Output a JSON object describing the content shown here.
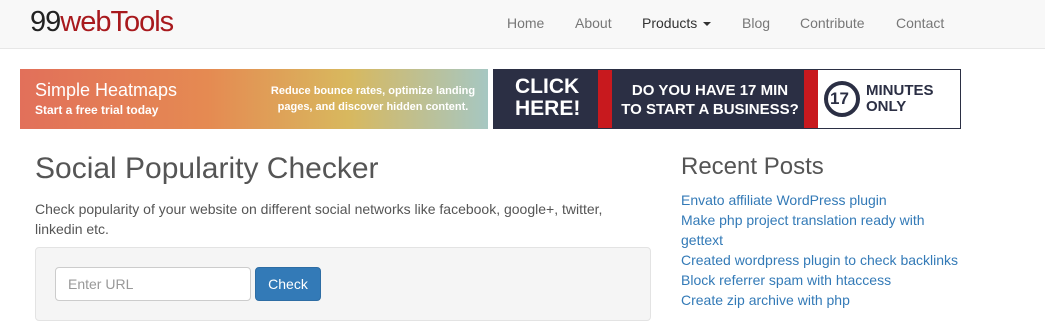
{
  "brand": {
    "part1": "99",
    "part2": "webTools"
  },
  "nav": {
    "items": [
      {
        "label": "Home"
      },
      {
        "label": "About"
      },
      {
        "label": "Products"
      },
      {
        "label": "Blog"
      },
      {
        "label": "Contribute"
      },
      {
        "label": "Contact"
      }
    ]
  },
  "ads": {
    "left": {
      "title": "Simple Heatmaps",
      "subtitle": "Start a free trial today",
      "body": "Reduce bounce rates, optimize landing pages, and discover hidden content."
    },
    "right": {
      "cta": "CLICK HERE!",
      "question": "DO YOU HAVE 17 MIN TO START A BUSINESS?",
      "logo": "17",
      "tagline": "MINUTES ONLY"
    }
  },
  "main": {
    "title": "Social Popularity Checker",
    "description": "Check popularity of your website on different social networks like facebook, google+, twitter, linkedin etc.",
    "url_placeholder": "Enter URL",
    "check_label": "Check"
  },
  "sidebar": {
    "recent_title": "Recent Posts",
    "posts": [
      {
        "label": "Envato affiliate WordPress plugin"
      },
      {
        "label": "Make php project translation ready with gettext"
      },
      {
        "label": "Created wordpress plugin to check backlinks"
      },
      {
        "label": "Block referrer spam with htaccess"
      },
      {
        "label": "Create zip archive with php"
      }
    ]
  },
  "colors": {
    "link": "#337ab7",
    "brand_red": "#a8191d",
    "button": "#337ab7"
  }
}
